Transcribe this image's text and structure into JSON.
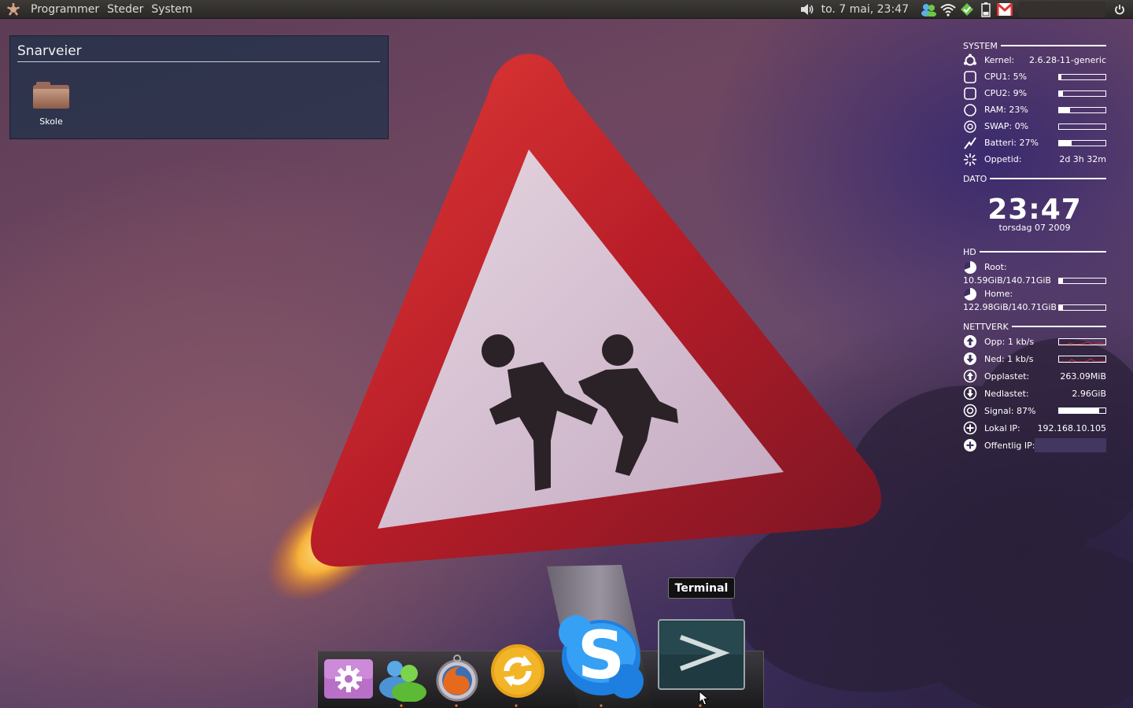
{
  "top_panel": {
    "menus": [
      "Programmer",
      "Steder",
      "System"
    ],
    "clock": "to.  7 mai, 23:47"
  },
  "shortcuts_widget": {
    "title": "Snarveier",
    "items": [
      {
        "label": "Skole",
        "icon": "folder-icon"
      }
    ]
  },
  "conky": {
    "system": {
      "header": "SYSTEM",
      "kernel_label": "Kernel:",
      "kernel_value": "2.6.28-11-generic",
      "cpu1_label": "CPU1: 5%",
      "cpu1_level": 0.05,
      "cpu2_label": "CPU2: 9%",
      "cpu2_level": 0.09,
      "ram_label": "RAM: 23%",
      "ram_level": 0.23,
      "swap_label": "SWAP: 0%",
      "swap_level": 0.0,
      "battery_label": "Batteri: 27%",
      "battery_level": 0.27,
      "uptime_label": "Oppetid:",
      "uptime_value": "2d 3h 32m"
    },
    "date": {
      "header": "DATO",
      "time": "23:47",
      "date_line": "torsdag 07 2009"
    },
    "hd": {
      "header": "HD",
      "root_label": "Root:",
      "root_usage": "10.59GiB/140.71GiB",
      "root_level": 0.08,
      "home_label": "Home:",
      "home_usage": "122.98GiB/140.71GiB",
      "home_level": 0.08
    },
    "network": {
      "header": "NETTVERK",
      "up_label": "Opp: 1 kb/s",
      "down_label": "Ned: 1 kb/s",
      "uploaded_label": "Opplastet:",
      "uploaded_value": "263.09MiB",
      "downloaded_label": "Nedlastet:",
      "downloaded_value": "2.96GiB",
      "signal_label": "Signal: 87%",
      "signal_level": 0.87,
      "local_ip_label": "Lokal IP:",
      "local_ip_value": "192.168.10.105",
      "public_ip_label": "Offentlig IP:"
    }
  },
  "dock": {
    "tooltip": "Terminal",
    "items": [
      "settings-icon",
      "messenger-icon",
      "firefox-icon",
      "update-icon",
      "skype-icon",
      "terminal-icon"
    ]
  },
  "colors": {
    "panel": "#2f2d2b",
    "widget_bg": "#1c3048",
    "sign_red": "#c8262a",
    "sign_inner": "#d9c6d4"
  }
}
